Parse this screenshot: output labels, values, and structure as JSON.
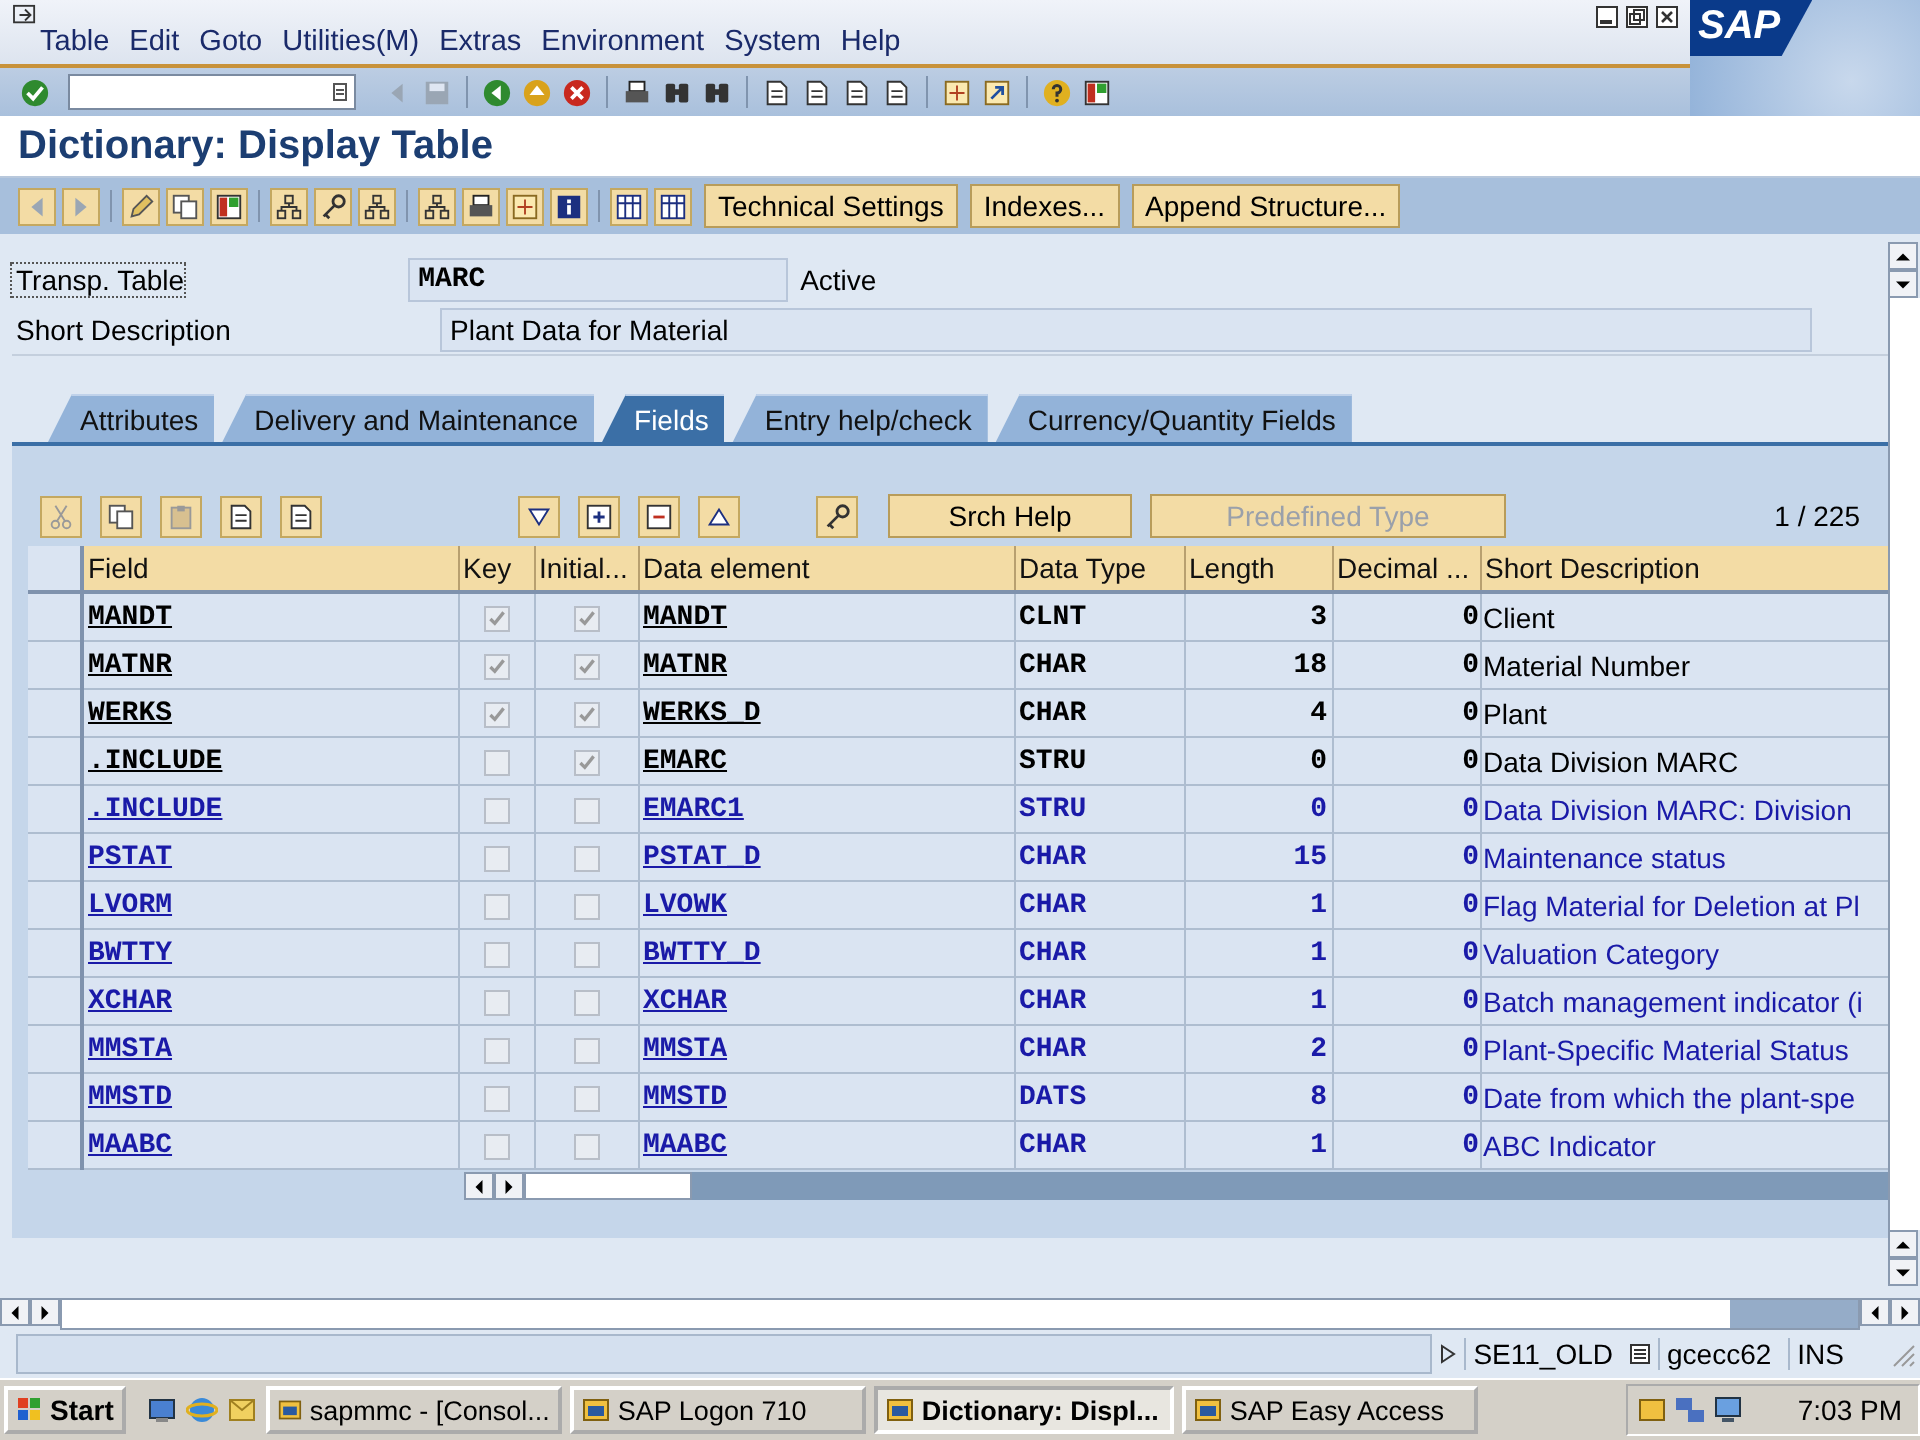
{
  "menu_bar": {
    "items": [
      "Table",
      "Edit",
      "Goto",
      "Utilities(M)",
      "Extras",
      "Environment",
      "System",
      "Help"
    ],
    "logo": "SAP"
  },
  "screen_title": "Dictionary: Display Table",
  "app_toolbar": {
    "buttons": [
      "Technical Settings",
      "Indexes...",
      "Append Structure..."
    ]
  },
  "header": {
    "table_label": "Transp. Table",
    "table_name": "MARC",
    "status": "Active",
    "description_label": "Short Description",
    "description": "Plant Data for Material"
  },
  "tabs": [
    {
      "label": "Attributes",
      "selected": false
    },
    {
      "label": "Delivery and Maintenance",
      "selected": false
    },
    {
      "label": "Fields",
      "selected": true
    },
    {
      "label": "Entry help/check",
      "selected": false
    },
    {
      "label": "Currency/Quantity Fields",
      "selected": false
    }
  ],
  "table_toolbar": {
    "buttons": [
      {
        "label": "Srch Help",
        "disabled": false
      },
      {
        "label": "Predefined Type",
        "disabled": true
      }
    ],
    "position": "1 / 225"
  },
  "table": {
    "columns": [
      "Field",
      "Key",
      "Initial...",
      "Data element",
      "Data Type",
      "Length",
      "Decimal ...",
      "Short Description"
    ],
    "rows": [
      {
        "field": "MANDT",
        "key": true,
        "initial": true,
        "data_element": "MANDT",
        "data_type": "CLNT",
        "length": "3",
        "decimal": "0",
        "description": "Client",
        "color": "#000000"
      },
      {
        "field": "MATNR",
        "key": true,
        "initial": true,
        "data_element": "MATNR",
        "data_type": "CHAR",
        "length": "18",
        "decimal": "0",
        "description": "Material Number",
        "color": "#000000"
      },
      {
        "field": "WERKS",
        "key": true,
        "initial": true,
        "data_element": "WERKS_D",
        "data_type": "CHAR",
        "length": "4",
        "decimal": "0",
        "description": "Plant",
        "color": "#000000"
      },
      {
        "field": ".INCLUDE",
        "key": false,
        "initial": true,
        "data_element": "EMARC",
        "data_type": "STRU",
        "length": "0",
        "decimal": "0",
        "description": "Data Division MARC",
        "color": "#000000"
      },
      {
        "field": ".INCLUDE",
        "key": false,
        "initial": false,
        "data_element": "EMARC1",
        "data_type": "STRU",
        "length": "0",
        "decimal": "0",
        "description": "Data Division MARC: Division",
        "color": "#1a1aa8"
      },
      {
        "field": "PSTAT",
        "key": false,
        "initial": false,
        "data_element": "PSTAT_D",
        "data_type": "CHAR",
        "length": "15",
        "decimal": "0",
        "description": "Maintenance status",
        "color": "#1a1aa8"
      },
      {
        "field": "LVORM",
        "key": false,
        "initial": false,
        "data_element": "LVOWK",
        "data_type": "CHAR",
        "length": "1",
        "decimal": "0",
        "description": "Flag Material for Deletion at Pl",
        "color": "#1a1aa8"
      },
      {
        "field": "BWTTY",
        "key": false,
        "initial": false,
        "data_element": "BWTTY_D",
        "data_type": "CHAR",
        "length": "1",
        "decimal": "0",
        "description": "Valuation Category",
        "color": "#1a1aa8"
      },
      {
        "field": "XCHAR",
        "key": false,
        "initial": false,
        "data_element": "XCHAR",
        "data_type": "CHAR",
        "length": "1",
        "decimal": "0",
        "description": "Batch management indicator (i",
        "color": "#1a1aa8"
      },
      {
        "field": "MMSTA",
        "key": false,
        "initial": false,
        "data_element": "MMSTA",
        "data_type": "CHAR",
        "length": "2",
        "decimal": "0",
        "description": "Plant-Specific Material Status",
        "color": "#1a1aa8"
      },
      {
        "field": "MMSTD",
        "key": false,
        "initial": false,
        "data_element": "MMSTD",
        "data_type": "DATS",
        "length": "8",
        "decimal": "0",
        "description": "Date from which the plant-spe",
        "color": "#1a1aa8"
      },
      {
        "field": "MAABC",
        "key": false,
        "initial": false,
        "data_element": "MAABC",
        "data_type": "CHAR",
        "length": "1",
        "decimal": "0",
        "description": "ABC Indicator",
        "color": "#1a1aa8"
      }
    ]
  },
  "status_bar": {
    "transaction": "SE11_OLD",
    "server": "gcecc62",
    "mode": "INS"
  },
  "taskbar": {
    "start": "Start",
    "tasks": [
      {
        "label": "sapmmc - [Consol...",
        "selected": false
      },
      {
        "label": "SAP Logon 710",
        "selected": false
      },
      {
        "label": "Dictionary: Displ...",
        "selected": true
      },
      {
        "label": "SAP Easy Access",
        "selected": false
      }
    ],
    "clock": "7:03 PM"
  }
}
